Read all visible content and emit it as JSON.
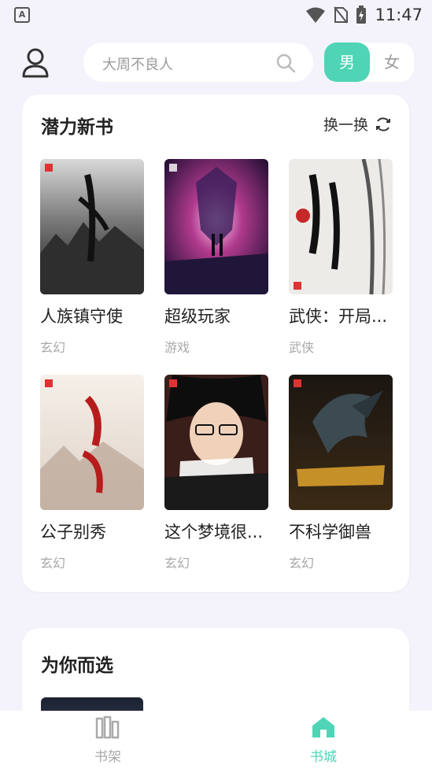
{
  "status_bar": {
    "time": "11:47",
    "app_indicator": "A"
  },
  "header": {
    "search_placeholder": "大周不良人",
    "gender_tabs": [
      {
        "label": "男",
        "selected": true
      },
      {
        "label": "女",
        "selected": false
      }
    ]
  },
  "section_potential": {
    "title": "潜力新书",
    "refresh_label": "换一换",
    "books": [
      {
        "title": "人族镇守使",
        "genre": "玄幻"
      },
      {
        "title": "超级玩家",
        "genre": "游戏"
      },
      {
        "title": "武侠：开局...",
        "genre": "武侠"
      },
      {
        "title": "公子别秀",
        "genre": "玄幻"
      },
      {
        "title": "这个梦境很...",
        "genre": "玄幻"
      },
      {
        "title": "不科学御兽",
        "genre": "玄幻"
      }
    ]
  },
  "section_for_you": {
    "title": "为你而选"
  },
  "bottom_nav": [
    {
      "label": "书架",
      "active": false
    },
    {
      "label": "书城",
      "active": true
    }
  ],
  "colors": {
    "accent": "#4fd5b6",
    "background": "#f4f3fb",
    "muted": "#a8a8a8"
  }
}
